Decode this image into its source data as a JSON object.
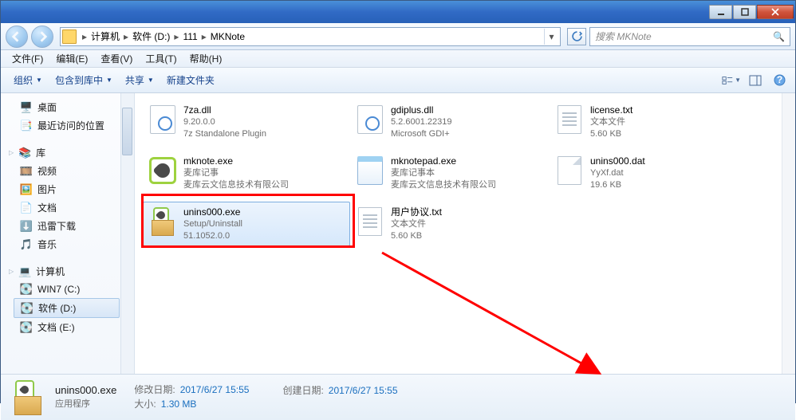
{
  "breadcrumbs": [
    "计算机",
    "软件 (D:)",
    "111",
    "MKNote"
  ],
  "search_placeholder": "搜索 MKNote",
  "menu": {
    "file": "文件(F)",
    "edit": "编辑(E)",
    "view": "查看(V)",
    "tools": "工具(T)",
    "help": "帮助(H)"
  },
  "toolbar": {
    "organize": "组织",
    "include": "包含到库中",
    "share": "共享",
    "newfolder": "新建文件夹"
  },
  "sidebar": {
    "favorites": [
      {
        "icon": "🖥️",
        "label": "桌面"
      },
      {
        "icon": "📑",
        "label": "最近访问的位置"
      }
    ],
    "lib_label": "库",
    "libs": [
      {
        "icon": "🎞️",
        "label": "视频"
      },
      {
        "icon": "🖼️",
        "label": "图片"
      },
      {
        "icon": "📄",
        "label": "文档"
      },
      {
        "icon": "⬇️",
        "label": "迅雷下载"
      },
      {
        "icon": "🎵",
        "label": "音乐"
      }
    ],
    "computer_label": "计算机",
    "drives": [
      {
        "icon": "💽",
        "label": "WIN7 (C:)"
      },
      {
        "icon": "💽",
        "label": "软件 (D:)",
        "selected": true
      },
      {
        "icon": "💽",
        "label": "文档 (E:)"
      }
    ]
  },
  "files": [
    {
      "name": "7za.dll",
      "l2": "9.20.0.0",
      "l3": "7z Standalone Plugin",
      "icon": "dll"
    },
    {
      "name": "gdiplus.dll",
      "l2": "5.2.6001.22319",
      "l3": "Microsoft GDI+",
      "icon": "dll"
    },
    {
      "name": "license.txt",
      "l2": "文本文件",
      "l3": "5.60 KB",
      "icon": "txt"
    },
    {
      "name": "mknote.exe",
      "l2": "麦库记事",
      "l3": "麦库云文信息技术有限公司",
      "icon": "mknote"
    },
    {
      "name": "mknotepad.exe",
      "l2": "麦库记事本",
      "l3": "麦库云文信息技术有限公司",
      "icon": "notepad"
    },
    {
      "name": "unins000.dat",
      "l2": "YyXf.dat",
      "l3": "19.6 KB",
      "icon": "dat"
    },
    {
      "name": "unins000.exe",
      "l2": "Setup/Uninstall",
      "l3": "51.1052.0.0",
      "icon": "box",
      "selected": true
    },
    {
      "name": "用户协议.txt",
      "l2": "文本文件",
      "l3": "5.60 KB",
      "icon": "txt"
    }
  ],
  "status": {
    "name": "unins000.exe",
    "type": "应用程序",
    "mod_label": "修改日期:",
    "mod": "2017/6/27 15:55",
    "create_label": "创建日期:",
    "create": "2017/6/27 15:55",
    "size_label": "大小:",
    "size": "1.30 MB"
  }
}
